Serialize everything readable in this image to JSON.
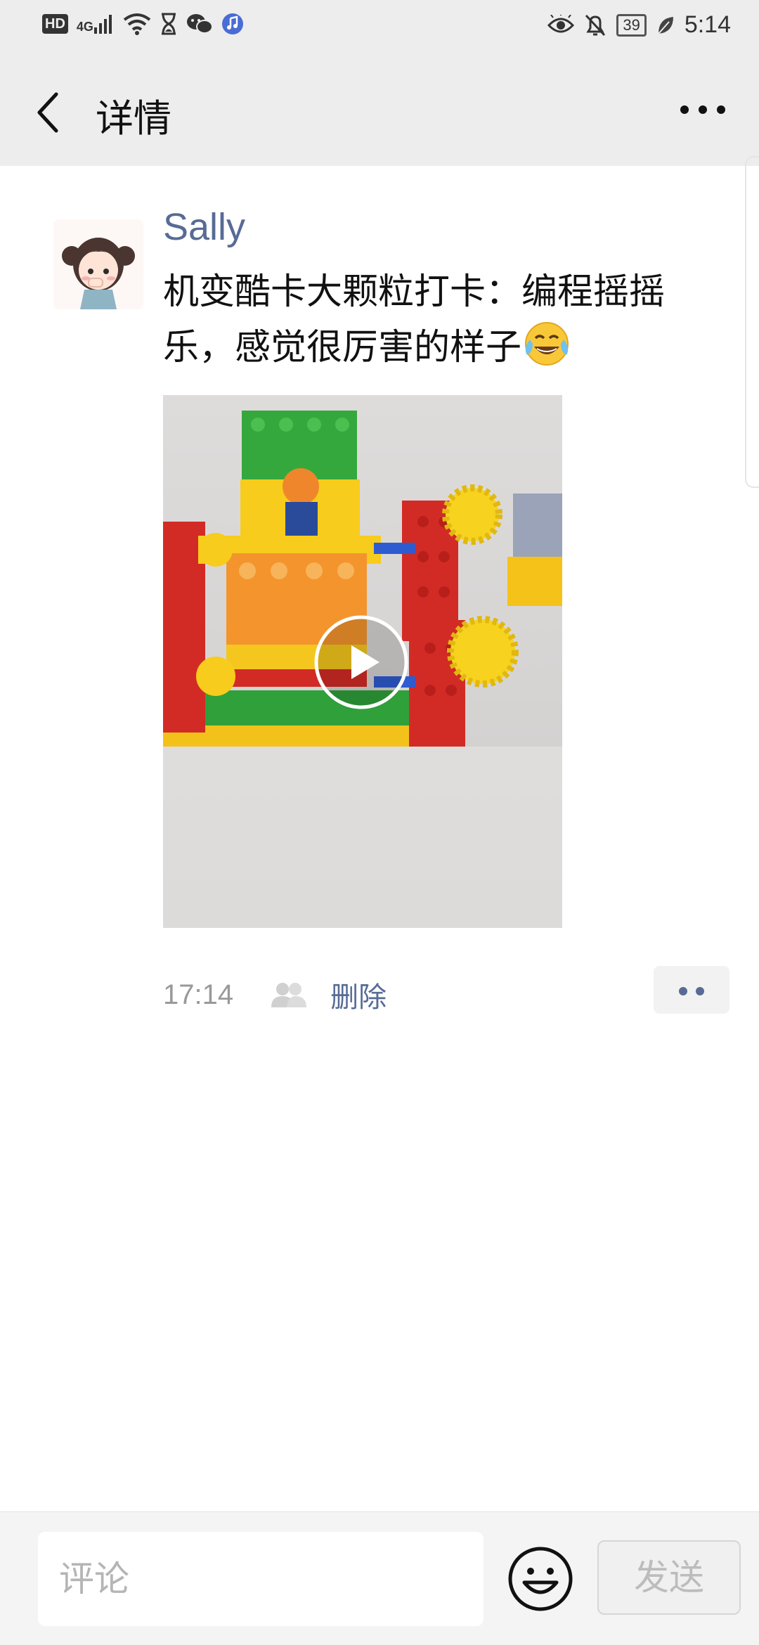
{
  "status_bar": {
    "left_icons": [
      "hd-icon",
      "4g-signal-icon",
      "wifi-icon",
      "hourglass-icon",
      "wechat-icon",
      "music-icon"
    ],
    "hd_label": "HD",
    "network_label": "4G",
    "battery": "39",
    "time": "5:14",
    "right_icons": [
      "eye-icon",
      "mute-bell-icon",
      "battery-icon",
      "leaf-icon"
    ]
  },
  "nav": {
    "title": "详情",
    "back_icon": "chevron-left-icon",
    "more_icon": "more-dots-icon"
  },
  "post": {
    "author": "Sally",
    "text": "机变酷卡大颗粒打卡：编程摇摇乐，感觉很厉害的样子",
    "emoji": "tears-of-joy-emoji",
    "video": {
      "play_icon": "play-icon"
    },
    "time": "17:14",
    "visibility_icon": "friends-icon",
    "delete_label": "删除",
    "action_icon": "two-dots-icon"
  },
  "comment_bar": {
    "placeholder": "评论",
    "value": "",
    "emoji_icon": "smiley-icon",
    "send_label": "发送"
  },
  "colors": {
    "link_blue": "#576b95",
    "header_bg": "#ededed",
    "bar_bg": "#f4f4f4"
  }
}
